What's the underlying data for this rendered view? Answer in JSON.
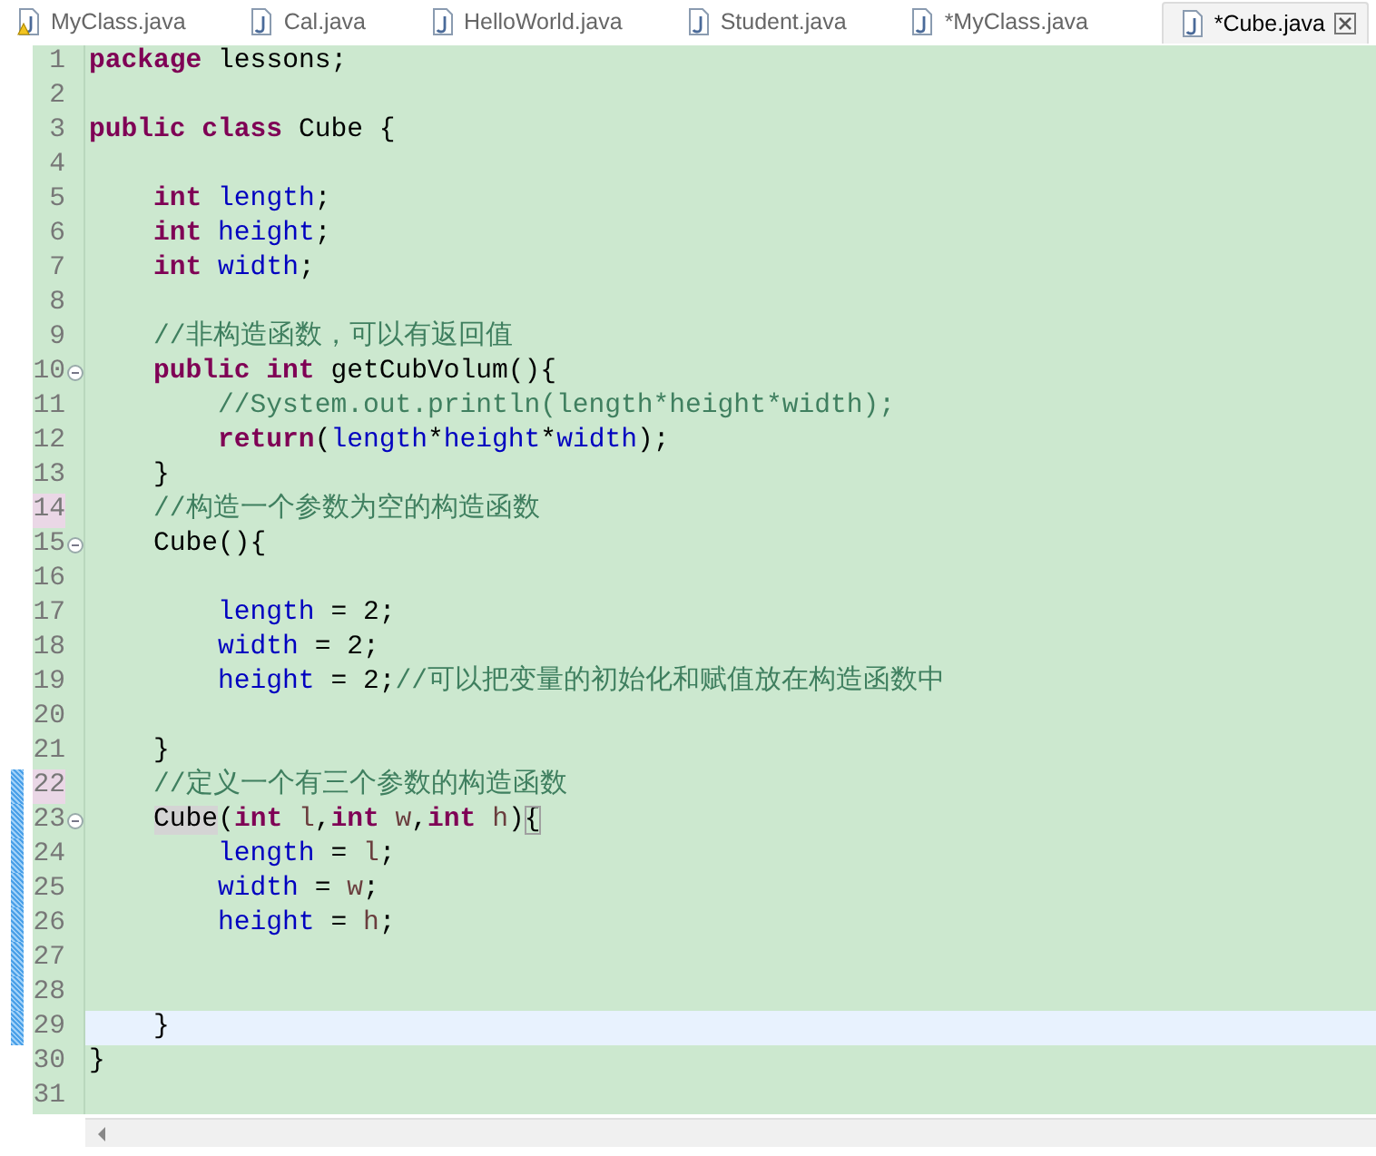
{
  "tabs": [
    {
      "label": "MyClass.java",
      "selected": false,
      "warning": true,
      "closable": false
    },
    {
      "label": "Cal.java",
      "selected": false,
      "warning": false,
      "closable": false
    },
    {
      "label": "HelloWorld.java",
      "selected": false,
      "warning": false,
      "closable": false
    },
    {
      "label": "Student.java",
      "selected": false,
      "warning": false,
      "closable": false
    },
    {
      "label": "*MyClass.java",
      "selected": false,
      "warning": false,
      "closable": false
    },
    {
      "label": "*Cube.java",
      "selected": true,
      "warning": false,
      "closable": true
    }
  ],
  "lines": [
    {
      "number": "1",
      "fold": false,
      "current": false,
      "changed": false,
      "marked": false,
      "tokens": [
        {
          "t": "package",
          "kind": "keyword"
        },
        {
          "t": " lessons;",
          "kind": "plain"
        }
      ]
    },
    {
      "number": "2",
      "fold": false,
      "current": false,
      "changed": false,
      "marked": false
    },
    {
      "number": "3",
      "fold": false,
      "current": false,
      "changed": false,
      "marked": false,
      "tokens": [
        {
          "t": "public class",
          "kind": "keyword"
        },
        {
          "t": " Cube {",
          "kind": "plain"
        }
      ]
    },
    {
      "number": "4",
      "fold": false,
      "current": false,
      "changed": false,
      "marked": false
    },
    {
      "number": "5",
      "fold": false,
      "current": false,
      "changed": false,
      "marked": false,
      "tokens": [
        {
          "t": "    int",
          "kind": "keyword"
        },
        {
          "t": " length",
          "kind": "field"
        },
        {
          "t": ";",
          "kind": "plain"
        }
      ]
    },
    {
      "number": "6",
      "fold": false,
      "current": false,
      "changed": false,
      "marked": false,
      "tokens": [
        {
          "t": "    int",
          "kind": "keyword"
        },
        {
          "t": " height",
          "kind": "field"
        },
        {
          "t": ";",
          "kind": "plain"
        }
      ]
    },
    {
      "number": "7",
      "fold": false,
      "current": false,
      "changed": false,
      "marked": false,
      "tokens": [
        {
          "t": "    int",
          "kind": "keyword"
        },
        {
          "t": " width",
          "kind": "field"
        },
        {
          "t": ";",
          "kind": "plain"
        }
      ]
    },
    {
      "number": "8",
      "fold": false,
      "current": false,
      "changed": false,
      "marked": false
    },
    {
      "number": "9",
      "fold": false,
      "current": false,
      "changed": false,
      "marked": false,
      "tokens": [
        {
          "t": "    //非构造函数，可以有返回值",
          "kind": "comment"
        }
      ]
    },
    {
      "number": "10",
      "fold": true,
      "current": false,
      "changed": false,
      "marked": false,
      "tokens": [
        {
          "t": "    public int",
          "kind": "keyword"
        },
        {
          "t": " getCubVolum(){",
          "kind": "plain"
        }
      ]
    },
    {
      "number": "11",
      "fold": false,
      "current": false,
      "changed": false,
      "marked": false,
      "tokens": [
        {
          "t": "        //System.out.println(length*height*width);",
          "kind": "comment"
        }
      ]
    },
    {
      "number": "12",
      "fold": false,
      "current": false,
      "changed": false,
      "marked": false,
      "tokens": [
        {
          "t": "        return",
          "kind": "keyword"
        },
        {
          "t": "(",
          "kind": "plain"
        },
        {
          "t": "length",
          "kind": "field"
        },
        {
          "t": "*",
          "kind": "plain"
        },
        {
          "t": "height",
          "kind": "field"
        },
        {
          "t": "*",
          "kind": "plain"
        },
        {
          "t": "width",
          "kind": "field"
        },
        {
          "t": ");",
          "kind": "plain"
        }
      ]
    },
    {
      "number": "13",
      "fold": false,
      "current": false,
      "changed": false,
      "marked": false,
      "tokens": [
        {
          "t": "    }",
          "kind": "plain"
        }
      ]
    },
    {
      "number": "14",
      "fold": false,
      "current": false,
      "changed": false,
      "marked": true,
      "tokens": [
        {
          "t": "    //构造一个参数为空的构造函数",
          "kind": "comment"
        }
      ]
    },
    {
      "number": "15",
      "fold": true,
      "current": false,
      "changed": false,
      "marked": false,
      "tokens": [
        {
          "t": "    Cube(){",
          "kind": "plain"
        }
      ]
    },
    {
      "number": "16",
      "fold": false,
      "current": false,
      "changed": false,
      "marked": false
    },
    {
      "number": "17",
      "fold": false,
      "current": false,
      "changed": false,
      "marked": false,
      "tokens": [
        {
          "t": "        length",
          "kind": "field"
        },
        {
          "t": " = 2;",
          "kind": "plain"
        }
      ]
    },
    {
      "number": "18",
      "fold": false,
      "current": false,
      "changed": false,
      "marked": false,
      "tokens": [
        {
          "t": "        width",
          "kind": "field"
        },
        {
          "t": " = 2;",
          "kind": "plain"
        }
      ]
    },
    {
      "number": "19",
      "fold": false,
      "current": false,
      "changed": false,
      "marked": false,
      "tokens": [
        {
          "t": "        height",
          "kind": "field"
        },
        {
          "t": " = 2;",
          "kind": "plain"
        },
        {
          "t": "//可以把变量的初始化和赋值放在构造函数中",
          "kind": "comment"
        }
      ]
    },
    {
      "number": "20",
      "fold": false,
      "current": false,
      "changed": false,
      "marked": false
    },
    {
      "number": "21",
      "fold": false,
      "current": false,
      "changed": false,
      "marked": false,
      "tokens": [
        {
          "t": "    }",
          "kind": "plain"
        }
      ]
    },
    {
      "number": "22",
      "fold": false,
      "current": false,
      "changed": true,
      "marked": true,
      "tokens": [
        {
          "t": "    //定义一个有三个参数的构造函数",
          "kind": "comment"
        }
      ]
    },
    {
      "number": "23",
      "fold": true,
      "current": false,
      "changed": true,
      "marked": false,
      "tokens": [
        {
          "t": "    Cube",
          "kind": "occurrence"
        },
        {
          "t": "(",
          "kind": "plain"
        },
        {
          "t": "int",
          "kind": "keyword"
        },
        {
          "t": " l",
          "kind": "param"
        },
        {
          "t": ",",
          "kind": "plain"
        },
        {
          "t": "int",
          "kind": "keyword"
        },
        {
          "t": " w",
          "kind": "param"
        },
        {
          "t": ",",
          "kind": "plain"
        },
        {
          "t": "int",
          "kind": "keyword"
        },
        {
          "t": " h",
          "kind": "param"
        },
        {
          "t": ")",
          "kind": "plain"
        },
        {
          "t": "{",
          "kind": "bracket"
        }
      ]
    },
    {
      "number": "24",
      "fold": false,
      "current": false,
      "changed": true,
      "marked": false,
      "tokens": [
        {
          "t": "        length",
          "kind": "field"
        },
        {
          "t": " = ",
          "kind": "plain"
        },
        {
          "t": "l",
          "kind": "param"
        },
        {
          "t": ";",
          "kind": "plain"
        }
      ]
    },
    {
      "number": "25",
      "fold": false,
      "current": false,
      "changed": true,
      "marked": false,
      "tokens": [
        {
          "t": "        width",
          "kind": "field"
        },
        {
          "t": " = ",
          "kind": "plain"
        },
        {
          "t": "w",
          "kind": "param"
        },
        {
          "t": ";",
          "kind": "plain"
        }
      ]
    },
    {
      "number": "26",
      "fold": false,
      "current": false,
      "changed": true,
      "marked": false,
      "tokens": [
        {
          "t": "        height",
          "kind": "field"
        },
        {
          "t": " = ",
          "kind": "plain"
        },
        {
          "t": "h",
          "kind": "param"
        },
        {
          "t": ";",
          "kind": "plain"
        }
      ]
    },
    {
      "number": "27",
      "fold": false,
      "current": false,
      "changed": true,
      "marked": false
    },
    {
      "number": "28",
      "fold": false,
      "current": false,
      "changed": true,
      "marked": false
    },
    {
      "number": "29",
      "fold": false,
      "current": true,
      "changed": true,
      "marked": false,
      "tokens": [
        {
          "t": "    }",
          "kind": "plain"
        }
      ]
    },
    {
      "number": "30",
      "fold": false,
      "current": false,
      "changed": false,
      "marked": false,
      "tokens": [
        {
          "t": "}",
          "kind": "plain"
        }
      ]
    },
    {
      "number": "31",
      "fold": false,
      "current": false,
      "changed": false,
      "marked": false
    }
  ]
}
